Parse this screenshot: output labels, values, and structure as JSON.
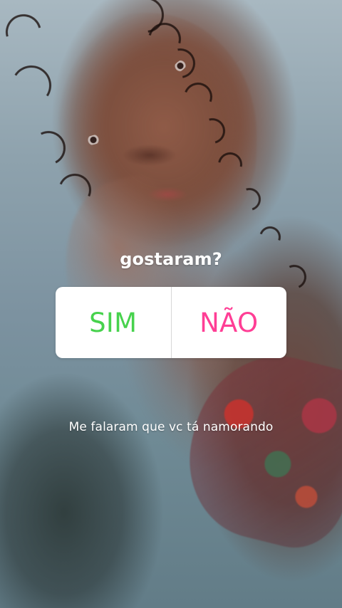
{
  "poll": {
    "question": "gostaram?",
    "options": [
      "SIM",
      "NÃO"
    ]
  },
  "caption": "Me falaram que vc tá namorando",
  "colors": {
    "question_text": "#ffffff",
    "card_background": "#ffffff",
    "option_yes": "#47d24d",
    "option_no": "#ff3e95",
    "caption_text": "#ffffff"
  }
}
